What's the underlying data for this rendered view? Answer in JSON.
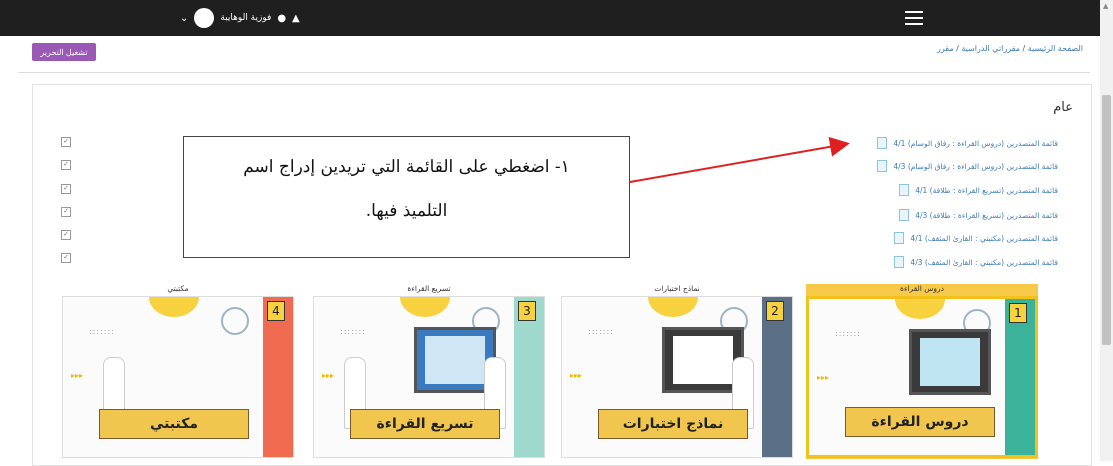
{
  "topbar": {
    "user_name": "فوزية الوهايبة",
    "chat_icon": "chat-icon",
    "bell_icon": "bell-icon",
    "menu_icon": "hamburger-icon"
  },
  "edit_button": "تشغيل التحرير",
  "breadcrumb": {
    "home": "الصفحة الرئيسية",
    "sep1": " / ",
    "courses": "مقرراتي الدراسية",
    "sep2": " / ",
    "current": "مقرر"
  },
  "section_title": "عام",
  "items": [
    {
      "label": "قائمة المتصدرين (دروس القراءة : رفاق الوسام) 4/1"
    },
    {
      "label": "قائمة المتصدرين (دروس القراءة : رفاق الوسام) 4/3"
    },
    {
      "label": "قائمة المتصدرين (تسريع القراءة : طلاقة) 4/1"
    },
    {
      "label": "قائمة المتصدرين (تسريع القراءة : طلاقة) 4/3"
    },
    {
      "label": "قائمة المتصدرين (مكتبتي : القارئ المثقف) 4/1"
    },
    {
      "label": "قائمة المتصدرين (مكتبتي : القارئ المثقف) 4/3"
    }
  ],
  "callout": {
    "line1": "١- اضغطي على القائمة التي تريدين إدراج اسم",
    "line2": "التلميذ فيها."
  },
  "tiles": [
    {
      "label": "دروس القراءة",
      "number": "1",
      "plate": "دروس القراءة",
      "strip": "#3bb29a"
    },
    {
      "label": "نماذج اختبارات",
      "number": "2",
      "plate": "نماذج اختبارات",
      "strip": "#5b6f86"
    },
    {
      "label": "تسريع القراءة",
      "number": "3",
      "plate": "تسريع القراءة",
      "strip": "#9fd8cc"
    },
    {
      "label": "مكتبتي",
      "number": "4",
      "plate": "مكتبتي",
      "strip": "#f06b4f"
    }
  ],
  "colors": {
    "accent": "#9b59b6",
    "link": "#3b7bbf",
    "highlight": "#f7c948",
    "arrow": "#e02020"
  }
}
